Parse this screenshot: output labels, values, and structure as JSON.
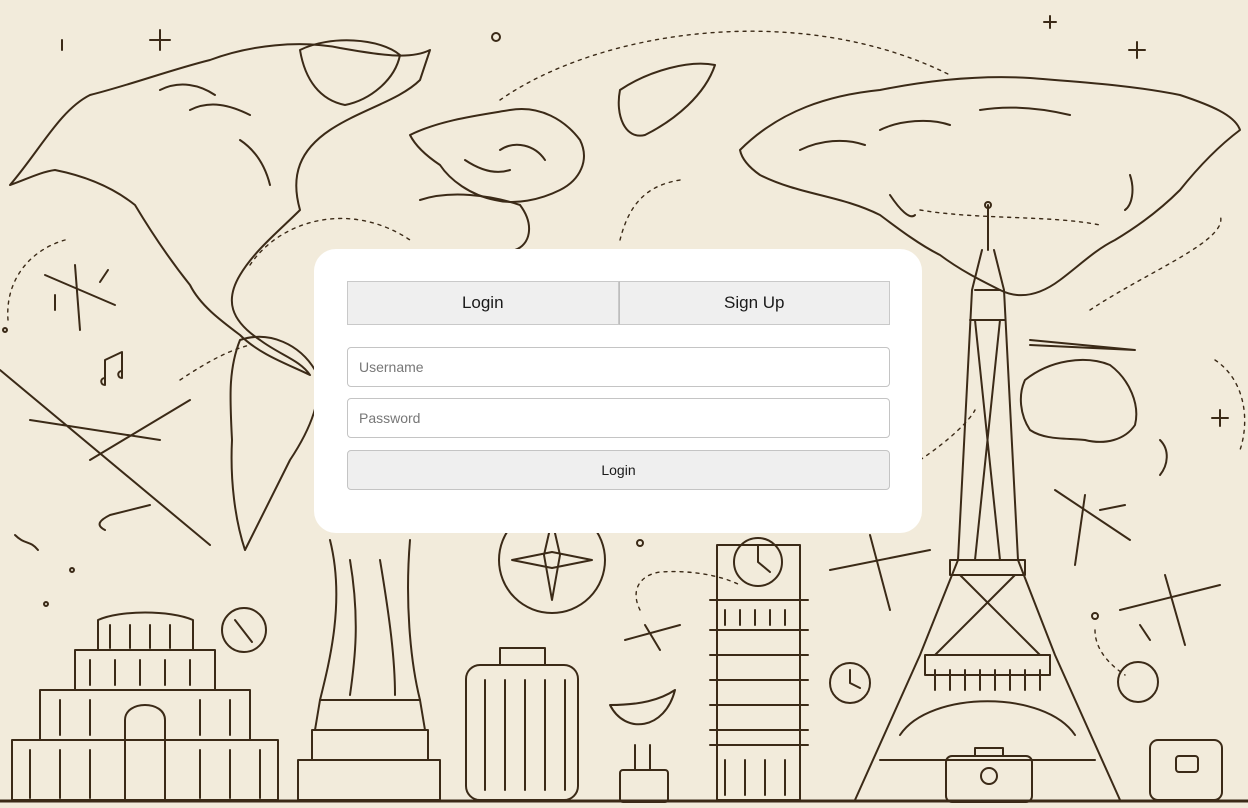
{
  "background": {
    "description_icons": [
      "world-map-icon",
      "airplane-icon",
      "eiffel-tower-icon",
      "big-ben-icon",
      "statue-of-liberty-icon",
      "suitcase-icon",
      "compass-icon",
      "clock-icon",
      "colosseum-icon"
    ],
    "colors": {
      "paper": "#f2ebdb",
      "ink": "#3b2a17"
    }
  },
  "auth": {
    "tabs": [
      {
        "label": "Login"
      },
      {
        "label": "Sign Up"
      }
    ],
    "username": {
      "placeholder": "Username",
      "value": ""
    },
    "password": {
      "placeholder": "Password",
      "value": ""
    },
    "submit_label": "Login"
  }
}
